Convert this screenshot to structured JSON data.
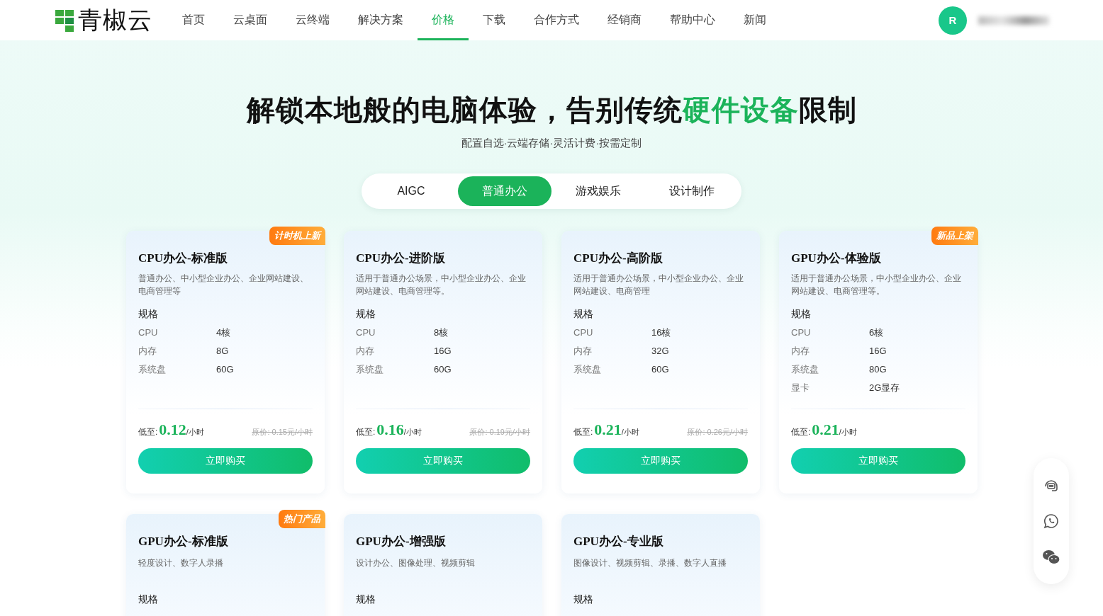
{
  "nav": {
    "logo": "青椒云",
    "items": [
      {
        "label": "首页",
        "selected": false
      },
      {
        "label": "云桌面",
        "selected": false
      },
      {
        "label": "云终端",
        "selected": false
      },
      {
        "label": "解决方案",
        "selected": false
      },
      {
        "label": "价格",
        "selected": true
      },
      {
        "label": "下载",
        "selected": false
      },
      {
        "label": "合作方式",
        "selected": false
      },
      {
        "label": "经销商",
        "selected": false
      },
      {
        "label": "帮助中心",
        "selected": false
      },
      {
        "label": "新闻",
        "selected": false
      }
    ],
    "avatar": "R"
  },
  "hero": {
    "title_before": "解锁本地般的电脑体验，告别传统",
    "title_highlight": "硬件设备",
    "title_after": "限制",
    "subtitle": "配置自选·云端存储·灵活计费·按需定制"
  },
  "tabs": [
    {
      "label": "AIGC",
      "selected": false
    },
    {
      "label": "普通办公",
      "selected": true
    },
    {
      "label": "游戏娱乐",
      "selected": false
    },
    {
      "label": "设计制作",
      "selected": false
    }
  ],
  "plans": [
    {
      "badge": "计时机上新",
      "title": "CPU办公-标准版",
      "description": "普通办公、中小型企业办公、企业网站建设、电商管理等",
      "spec_heading": "规格",
      "specs": [
        {
          "name": "CPU",
          "value": "4核"
        },
        {
          "name": "内存",
          "value": "8G"
        },
        {
          "name": "系统盘",
          "value": "60G"
        }
      ],
      "price_label": "低至:",
      "price": "0.12",
      "unit": "/小时",
      "original_price": "原价: 0.15元/小时",
      "button": "立即购买"
    },
    {
      "title": "CPU办公-进阶版",
      "description": "适用于普通办公场景，中小型企业办公、企业网站建设、电商管理等。",
      "spec_heading": "规格",
      "specs": [
        {
          "name": "CPU",
          "value": "8核"
        },
        {
          "name": "内存",
          "value": "16G"
        },
        {
          "name": "系统盘",
          "value": "60G"
        }
      ],
      "price_label": "低至:",
      "price": "0.16",
      "unit": "/小时",
      "original_price": "原价: 0.19元/小时",
      "button": "立即购买"
    },
    {
      "title": "CPU办公-高阶版",
      "description": "适用于普通办公场景，中小型企业办公、企业网站建设、电商管理",
      "spec_heading": "规格",
      "specs": [
        {
          "name": "CPU",
          "value": "16核"
        },
        {
          "name": "内存",
          "value": "32G"
        },
        {
          "name": "系统盘",
          "value": "60G"
        }
      ],
      "price_label": "低至:",
      "price": "0.21",
      "unit": "/小时",
      "original_price": "原价: 0.26元/小时",
      "button": "立即购买"
    },
    {
      "badge": "新品上架",
      "title": "GPU办公-体验版",
      "description": "适用于普通办公场景，中小型企业办公、企业网站建设、电商管理等。",
      "spec_heading": "规格",
      "specs": [
        {
          "name": "CPU",
          "value": "6核"
        },
        {
          "name": "内存",
          "value": "16G"
        },
        {
          "name": "系统盘",
          "value": "80G"
        },
        {
          "name": "显卡",
          "value": "2G显存"
        }
      ],
      "price_label": "低至:",
      "price": "0.21",
      "unit": "/小时",
      "button": "立即购买"
    },
    {
      "badge": "热门产品",
      "title": "GPU办公-标准版",
      "description": "轻度设计、数字人录播",
      "spec_heading": "规格"
    },
    {
      "title": "GPU办公-增强版",
      "description": "设计办公、图像处理、视频剪辑",
      "spec_heading": "规格"
    },
    {
      "title": "GPU办公-专业版",
      "description": "图像设计、视频剪辑、录播、数字人直播",
      "spec_heading": "规格"
    }
  ]
}
